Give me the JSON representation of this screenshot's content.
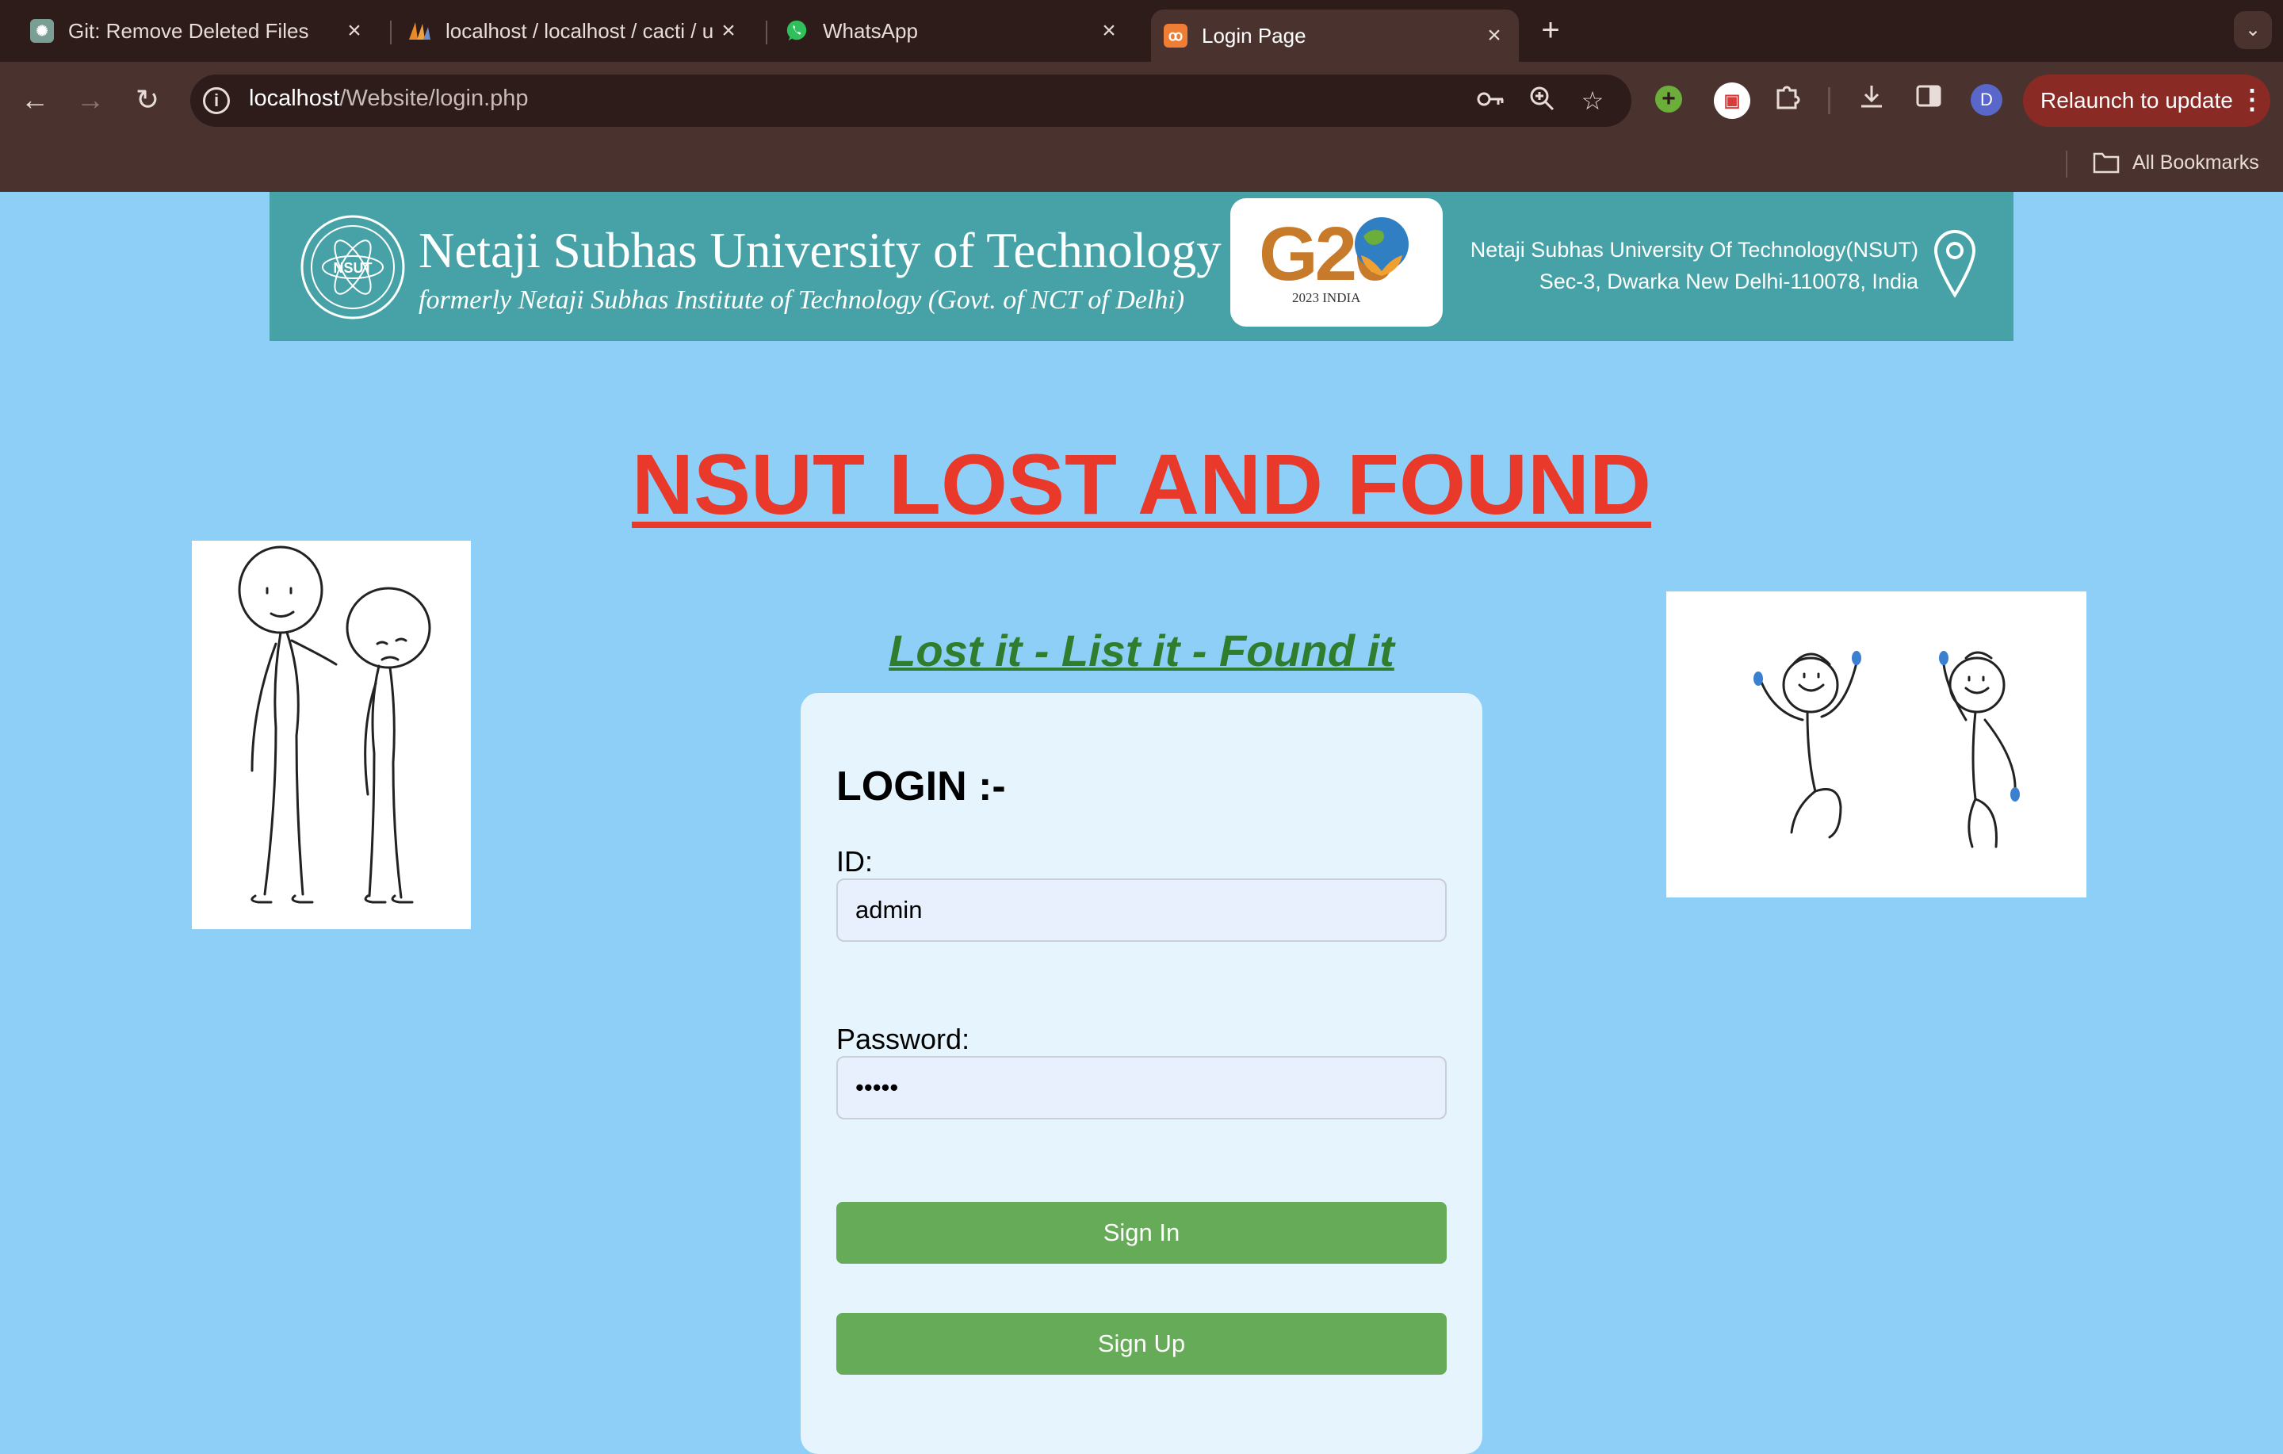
{
  "browser": {
    "tabs": [
      {
        "title": "Git: Remove Deleted Files",
        "icon": "openai-icon"
      },
      {
        "title": "localhost / localhost / cacti / u",
        "icon": "phpmyadmin-icon"
      },
      {
        "title": "WhatsApp",
        "icon": "whatsapp-icon"
      },
      {
        "title": "Login Page",
        "icon": "xampp-icon",
        "active": true
      }
    ],
    "url_host": "localhost",
    "url_path": "/Website/login.php",
    "profile_initial": "D",
    "relaunch_label": "Relaunch to update",
    "bookmarks_label": "All Bookmarks"
  },
  "banner": {
    "university_name": "Netaji Subhas University of Technology",
    "subtitle": "formerly Netaji Subhas Institute of Technology (Govt. of NCT of Delhi)",
    "seal_text": "NSUT",
    "g20_text": "G20",
    "g20_sub": "2023 INDIA",
    "address_line1": "Netaji Subhas University Of Technology(NSUT)",
    "address_line2": "Sec-3, Dwarka New Delhi-110078, India"
  },
  "page": {
    "headline": "NSUT LOST AND FOUND",
    "tagline": "Lost it - List it - Found it"
  },
  "login": {
    "heading": "LOGIN :-",
    "id_label": "ID:",
    "id_value": "admin",
    "password_label": "Password:",
    "password_value": "•••••",
    "sign_in_label": "Sign In",
    "sign_up_label": "Sign Up"
  },
  "colors": {
    "page_bg": "#8ecff7",
    "headline": "#e8392b",
    "tagline": "#2f7d2d",
    "button": "#66ab57",
    "banner": "#46a2a6"
  }
}
